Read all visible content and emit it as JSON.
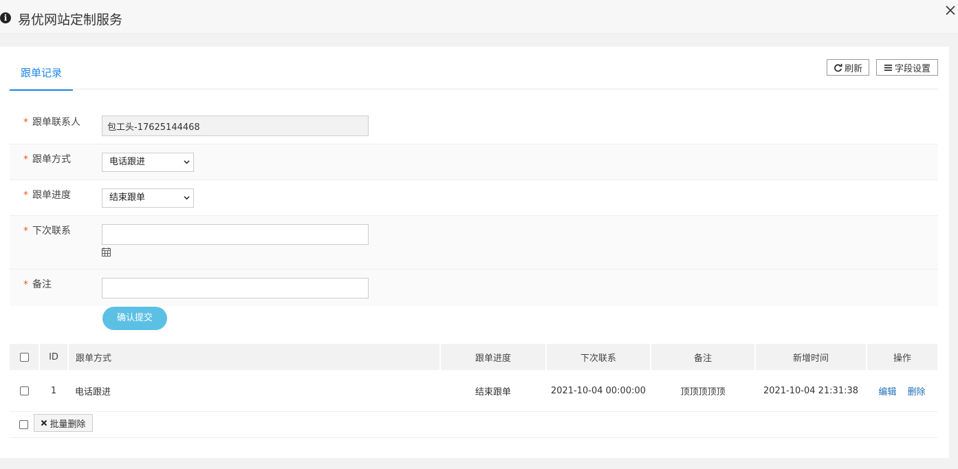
{
  "header": {
    "title": "易优网站定制服务"
  },
  "tabs": [
    {
      "label": "跟单记录"
    }
  ],
  "toolbar": {
    "refresh_label": "刷新",
    "fields_label": "字段设置"
  },
  "form": {
    "contact": {
      "label": "跟单联系人",
      "value": "包工头-17625144468"
    },
    "method": {
      "label": "跟单方式",
      "selected": "电话跟进"
    },
    "progress": {
      "label": "跟单进度",
      "selected": "结束跟单"
    },
    "next_contact": {
      "label": "下次联系",
      "value": ""
    },
    "remark": {
      "label": "备注",
      "value": ""
    },
    "required_mark": "*",
    "submit_label": "确认提交"
  },
  "table": {
    "headers": [
      "ID",
      "跟单方式",
      "跟单进度",
      "下次联系",
      "备注",
      "新增时间",
      "操作"
    ],
    "rows": [
      {
        "id": "1",
        "method": "电话跟进",
        "progress": "结束跟单",
        "next_contact": "2021-10-04 00:00:00",
        "remark": "顶顶顶顶顶",
        "created": "2021-10-04 21:31:38",
        "edit": "编辑",
        "delete": "删除"
      }
    ]
  },
  "batch": {
    "delete_label": "批量删除"
  },
  "colors": {
    "accent": "#1e88e5",
    "submit": "#5bc0e4",
    "required": "#f05a22",
    "link": "#1e6fb8"
  }
}
